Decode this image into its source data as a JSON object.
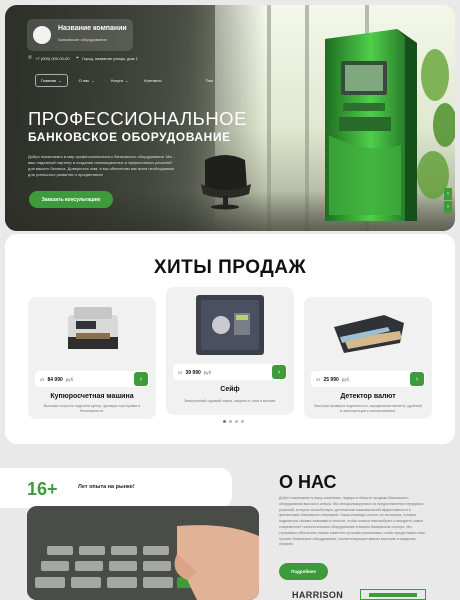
{
  "header": {
    "company_name": "Название компании",
    "company_sub": "Банковское оборудование",
    "phone": "+7 (000) 000-00-00",
    "address": "Город, название улицы, дом 1",
    "phone_icon": "phone-icon",
    "location_icon": "map-pin-icon"
  },
  "nav": {
    "items": [
      {
        "label": "Главная",
        "has_dropdown": true
      },
      {
        "label": "О нас",
        "has_dropdown": true
      },
      {
        "label": "Услуги",
        "has_dropdown": true
      },
      {
        "label": "Контакты",
        "has_dropdown": false
      },
      {
        "label": "Tool",
        "has_dropdown": false
      }
    ],
    "dropdown_glyph": "⌄"
  },
  "hero": {
    "title_line1": "ПРОФЕССИОНАЛЬНОЕ",
    "title_line2": "БАНКОВСКОЕ ОБОРУДОВАНИЕ",
    "text": "Добро пожаловать в мир профессионального банковского оборудования. Мы - ваш надежный партнер в создании инновационных и эффективных решений для вашего бизнеса. Доверьтесь нам, и мы обеспечим вас всем необходимым для успешного развития и процветания!",
    "cta": "Заказать консультацию",
    "arrow_up": "‹",
    "arrow_down": "›"
  },
  "hits": {
    "title": "ХИТЫ ПРОДАЖ",
    "products": [
      {
        "price_prefix": "от",
        "price": "84 990",
        "currency": "руб",
        "name": "Купюросчетная машина",
        "desc": "Высокая скорость подсчета купюр, функция сортировки и безопасности.",
        "arrow": "›"
      },
      {
        "price_prefix": "от",
        "price": "39 990",
        "currency": "руб",
        "name": "Сейф",
        "desc": "Электронный кодовый замок, защита от огня и взлома.",
        "arrow": "›"
      },
      {
        "price_prefix": "от",
        "price": "25 990",
        "currency": "руб",
        "name": "Детектор валют",
        "desc": "Быстрая проверка подлинности, определение валюты, удобный в эксплуатации и использовании.",
        "arrow": "›"
      }
    ]
  },
  "about": {
    "stat_number": "16+",
    "stat_label": "Лет опыта на рынке!",
    "title": "О НАС",
    "text": "Добро пожаловать в нашу компанию, лидера в области продажи банковского оборудования высокого класса. Мы специализируемся на предоставлении передовых решений, которые способствуют достижению максимальной эффективности в финансовых банковских операциях. Наша команда состоит из экспертов, готовых поделиться своими знаниями и опытом, чтобы помочь вам выбрать и внедрить самое современное технологическое оборудование в вашем банковском секторе. Мы стремимся обеспечить наших клиентов лучшими решениями, чтобы предоставить вам лучшее банковское оборудование, соответствующее вашим высоким стандартам отрасли.",
    "more_button": "Подробнее",
    "brand_1": "HARRISON"
  },
  "colors": {
    "accent": "#3e9b3b",
    "dark_text": "#111111",
    "muted_text": "#777777"
  }
}
